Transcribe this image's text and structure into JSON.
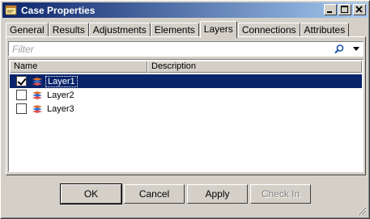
{
  "window": {
    "title": "Case Properties",
    "minimize": "_",
    "maximize": "□",
    "close": "✕"
  },
  "tabs": [
    {
      "label": "General",
      "active": false
    },
    {
      "label": "Results",
      "active": false
    },
    {
      "label": "Adjustments",
      "active": false
    },
    {
      "label": "Elements",
      "active": false
    },
    {
      "label": "Layers",
      "active": true
    },
    {
      "label": "Connections",
      "active": false
    },
    {
      "label": "Attributes",
      "active": false
    }
  ],
  "filter": {
    "placeholder": "Filter",
    "value": ""
  },
  "list": {
    "columns": [
      "Name",
      "Description"
    ],
    "rows": [
      {
        "name": "Layer1",
        "description": "",
        "checked": true,
        "selected": true
      },
      {
        "name": "Layer2",
        "description": "",
        "checked": false,
        "selected": false
      },
      {
        "name": "Layer3",
        "description": "",
        "checked": false,
        "selected": false
      }
    ]
  },
  "buttons": {
    "ok": "OK",
    "cancel": "Cancel",
    "apply": "Apply",
    "check_in": "Check In"
  },
  "colors": {
    "selection": "#0a246a",
    "titlebar_start": "#0a246a",
    "titlebar_end": "#a6caf0",
    "face": "#d4d0c8"
  }
}
